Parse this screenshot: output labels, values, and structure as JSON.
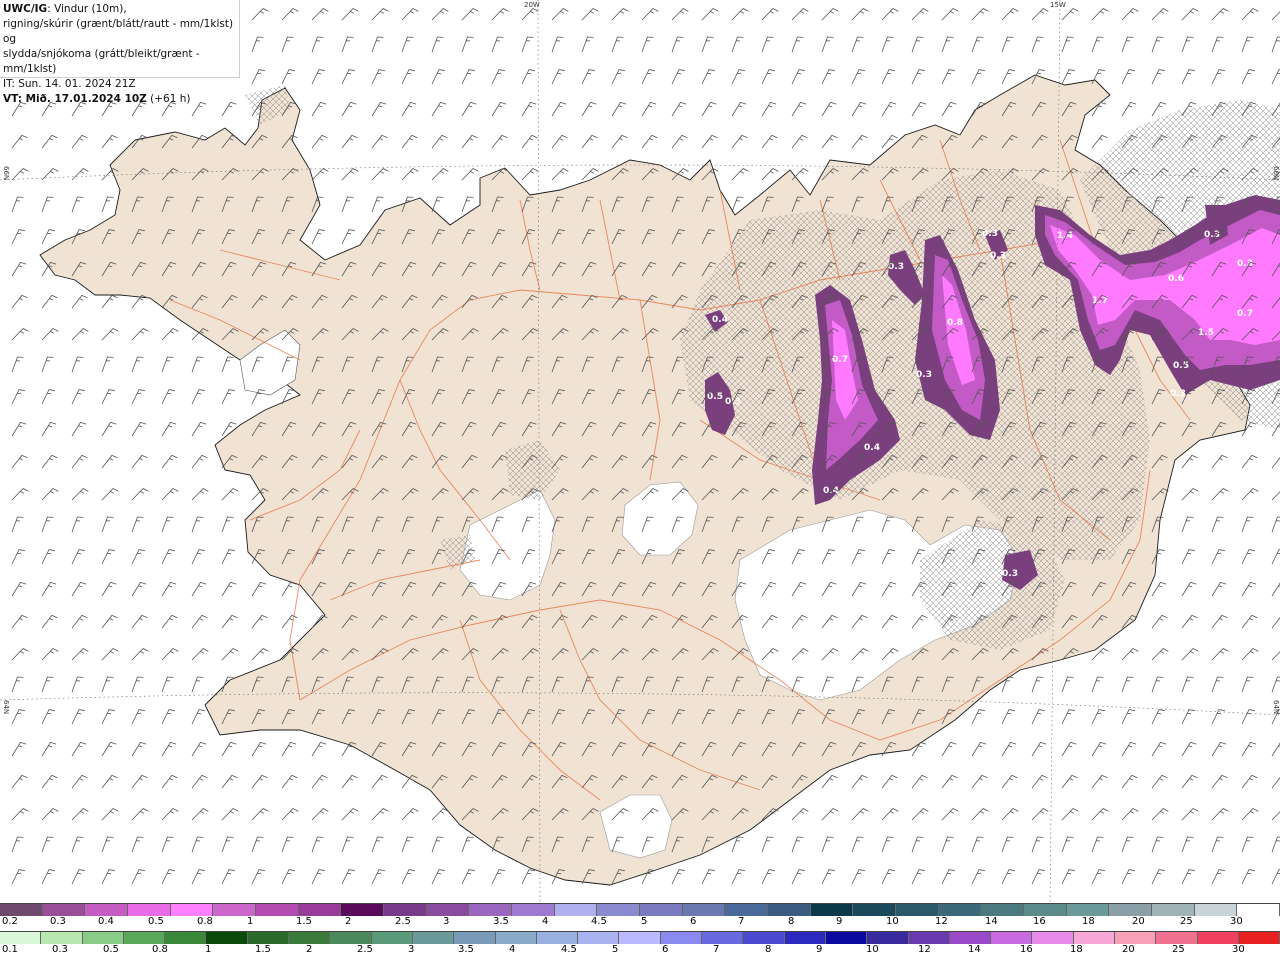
{
  "header": {
    "model": "UWC/IG",
    "line1_rest": ": Vindur (10m),",
    "line2": "rigning/skúrir (grænt/blátt/rautt - mm/1klst) og",
    "line3": "slydda/snjókoma (grátt/bleikt/grænt - mm/1klst)",
    "it": "IT: Sun. 14. 01. 2024 21Z",
    "vt_label": "VT:",
    "vt_value": " Mið. 17.01.2024 10Z",
    "vt_offset": " (+61 h)"
  },
  "graticule": {
    "lon_top": [
      "20W",
      "15W"
    ],
    "lat_left": [
      "66N",
      "64N"
    ],
    "lat_right": [
      "66N",
      "64N"
    ]
  },
  "colors": {
    "land": "#f1e3d4",
    "sea": "#ffffff",
    "roads": "#e8764a",
    "snow_dark": "#7a3f7d",
    "snow_mid": "#c35bc6",
    "snow_light": "#ff7aff"
  },
  "precip_labels": [
    "1.4",
    "0.3",
    "0.3",
    "0.3",
    "0.3",
    "0.6",
    "1.7",
    "0.3",
    "0.4",
    "0.8",
    "0.7",
    "0.5",
    "0.3",
    "0.3",
    "0.4",
    "0.4",
    "1.5",
    "0.7",
    "0.5",
    "0.3",
    "0.3"
  ],
  "legend_snow": {
    "colors": [
      "#6e4a6e",
      "#9a4e9a",
      "#c45cc4",
      "#e86be8",
      "#ff80ff",
      "#cc66cc",
      "#b44cb4",
      "#9a3a9a",
      "#5a0a5a",
      "#7a3a8a",
      "#8a4aa0",
      "#9a66c0",
      "#a07ad0",
      "#b0b0f0",
      "#8a8ad0",
      "#7a7ac0",
      "#6a7ab0",
      "#4a6a9a",
      "#3a5a80",
      "#0a3a4a",
      "#1a4a5a",
      "#2a5a6a",
      "#3a6a7a",
      "#4a7a80",
      "#5a8a8a",
      "#6a9a9a",
      "#8aa0a8",
      "#a0b4b8",
      "#c8d4d8",
      "#ffffff"
    ],
    "labels": [
      "0.2",
      "0.3",
      "0.4",
      "0.5",
      "0.8",
      "1",
      "1.5",
      "2",
      "2.5",
      "3",
      "3.5",
      "4",
      "4.5",
      "5",
      "6",
      "7",
      "8",
      "9",
      "10",
      "12",
      "14",
      "16",
      "18",
      "20",
      "25",
      "30"
    ]
  },
  "legend_rain": {
    "colors": [
      "#d8f8d8",
      "#b8e8b0",
      "#88cc88",
      "#5aa85a",
      "#3a883a",
      "#0a4a0a",
      "#2a6a2a",
      "#3a7a3a",
      "#4a8a5a",
      "#5a9a7a",
      "#6a9a9a",
      "#7a9aba",
      "#8aaaca",
      "#9ab0e0",
      "#aab4f0",
      "#bab8ff",
      "#8a8af0",
      "#6a6ae0",
      "#4a4ad0",
      "#2a2ac0",
      "#0a0aa0",
      "#3a2aa0",
      "#6a3ab0",
      "#9a4ac8",
      "#c86ae0",
      "#e88ae8",
      "#f8a8d8",
      "#f8a0b8",
      "#f07090",
      "#f04060",
      "#e82020"
    ],
    "labels": [
      "0.1",
      "0.3",
      "0.5",
      "0.8",
      "1",
      "1.5",
      "2",
      "2.5",
      "3",
      "3.5",
      "4",
      "4.5",
      "5",
      "6",
      "7",
      "8",
      "9",
      "10",
      "12",
      "14",
      "16",
      "18",
      "20",
      "25",
      "30"
    ]
  }
}
